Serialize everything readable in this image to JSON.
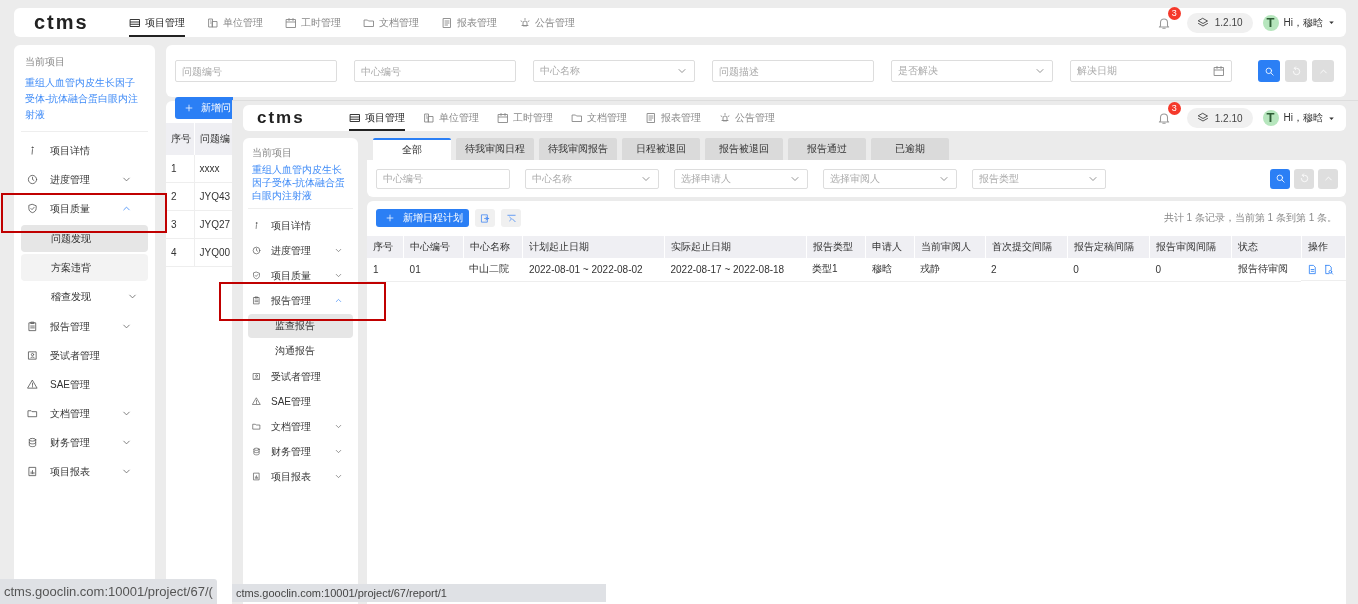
{
  "main_app": {
    "header": {
      "logo": "ctms",
      "nav": [
        {
          "label": "项目管理",
          "selected": true
        },
        {
          "label": "单位管理",
          "selected": false
        },
        {
          "label": "工时管理",
          "selected": false
        },
        {
          "label": "文档管理",
          "selected": false
        },
        {
          "label": "报表管理",
          "selected": false
        },
        {
          "label": "公告管理",
          "selected": false
        }
      ],
      "notification_count": "3",
      "version": "1.2.10",
      "avatar": "T",
      "greeting": "Hi，穆晗"
    },
    "sidebar": {
      "caption": "当前项目",
      "project": "重组人血管内皮生长因子受体-抗体融合蛋白眼内注射液",
      "items": [
        {
          "label": "项目详情",
          "kind": "link"
        },
        {
          "label": "进度管理",
          "kind": "group",
          "expanded": false
        },
        {
          "label": "项目质量",
          "kind": "group",
          "expanded": true,
          "children": [
            {
              "label": "问题发现",
              "kind": "link",
              "selected": true,
              "hovered": false
            },
            {
              "label": "方案违背",
              "kind": "link",
              "selected": false,
              "hovered": true
            },
            {
              "label": "稽查发现",
              "kind": "group",
              "expanded": false
            }
          ]
        },
        {
          "label": "报告管理",
          "kind": "group",
          "expanded": false
        },
        {
          "label": "受试者管理",
          "kind": "link"
        },
        {
          "label": "SAE管理",
          "kind": "link"
        },
        {
          "label": "文档管理",
          "kind": "group",
          "expanded": false
        },
        {
          "label": "财务管理",
          "kind": "group",
          "expanded": false
        },
        {
          "label": "项目报表",
          "kind": "group",
          "expanded": false
        }
      ]
    },
    "filters": [
      {
        "placeholder": "问题编号",
        "kind": "text"
      },
      {
        "placeholder": "中心编号",
        "kind": "text"
      },
      {
        "placeholder": "中心名称",
        "kind": "select"
      },
      {
        "placeholder": "问题描述",
        "kind": "text"
      },
      {
        "placeholder": "是否解决",
        "kind": "select"
      },
      {
        "placeholder": "解决日期",
        "kind": "date"
      }
    ],
    "add_button": "新增问",
    "table": {
      "columns": [
        "序号",
        "问题编"
      ],
      "rows": [
        [
          "1",
          "xxxx"
        ],
        [
          "2",
          "JYQ43"
        ],
        [
          "3",
          "JYQ27"
        ],
        [
          "4",
          "JYQ00"
        ]
      ]
    },
    "status_bar": "ctms.gooclin.com:10001/project/67/("
  },
  "overlay_window": {
    "header": {
      "logo": "ctms",
      "nav": [
        {
          "label": "项目管理",
          "selected": true
        },
        {
          "label": "单位管理",
          "selected": false
        },
        {
          "label": "工时管理",
          "selected": false
        },
        {
          "label": "文档管理",
          "selected": false
        },
        {
          "label": "报表管理",
          "selected": false
        },
        {
          "label": "公告管理",
          "selected": false
        }
      ],
      "notification_count": "3",
      "version": "1.2.10",
      "avatar": "T",
      "greeting": "Hi，穆晗"
    },
    "sidebar": {
      "caption": "当前项目",
      "project": "重组人血管内皮生长因子受体-抗体融合蛋白眼内注射液",
      "items": [
        {
          "label": "项目详情",
          "kind": "link"
        },
        {
          "label": "进度管理",
          "kind": "group",
          "expanded": false
        },
        {
          "label": "项目质量",
          "kind": "group",
          "expanded": false
        },
        {
          "label": "报告管理",
          "kind": "group",
          "expanded": true,
          "children": [
            {
              "label": "监查报告",
              "kind": "link",
              "selected": true,
              "hovered": false
            },
            {
              "label": "沟通报告",
              "kind": "link",
              "selected": false,
              "hovered": false
            }
          ]
        },
        {
          "label": "受试者管理",
          "kind": "link"
        },
        {
          "label": "SAE管理",
          "kind": "link"
        },
        {
          "label": "文档管理",
          "kind": "group",
          "expanded": false
        },
        {
          "label": "财务管理",
          "kind": "group",
          "expanded": false
        },
        {
          "label": "项目报表",
          "kind": "group",
          "expanded": false
        }
      ]
    },
    "tabs": [
      {
        "label": "全部",
        "selected": true
      },
      {
        "label": "待我审阅日程",
        "selected": false
      },
      {
        "label": "待我审阅报告",
        "selected": false
      },
      {
        "label": "日程被退回",
        "selected": false
      },
      {
        "label": "报告被退回",
        "selected": false
      },
      {
        "label": "报告通过",
        "selected": false
      },
      {
        "label": "已逾期",
        "selected": false
      }
    ],
    "filters": [
      {
        "placeholder": "中心编号",
        "kind": "text"
      },
      {
        "placeholder": "中心名称",
        "kind": "select"
      },
      {
        "placeholder": "选择申请人",
        "kind": "select"
      },
      {
        "placeholder": "选择审阅人",
        "kind": "select"
      },
      {
        "placeholder": "报告类型",
        "kind": "select"
      }
    ],
    "add_button": "新增日程计划",
    "summary": "共计 1 条记录，当前第 1 条到第 1 条。",
    "table": {
      "columns": [
        "序号",
        "中心编号",
        "中心名称",
        "计划起止日期",
        "实际起止日期",
        "报告类型",
        "申请人",
        "当前审阅人",
        "首次提交间隔",
        "报告定稿间隔",
        "报告审阅间隔",
        "状态",
        "操作"
      ],
      "rows": [
        [
          "1",
          "01",
          "中山二院",
          "2022-08-01 ~ 2022-08-02",
          "2022-08-17 ~ 2022-08-18",
          "类型1",
          "穆晗",
          "戎静",
          "2",
          "0",
          "0",
          "报告待审阅"
        ]
      ]
    },
    "status_bar": "ctms.gooclin.com:10001/project/67/report/1"
  }
}
